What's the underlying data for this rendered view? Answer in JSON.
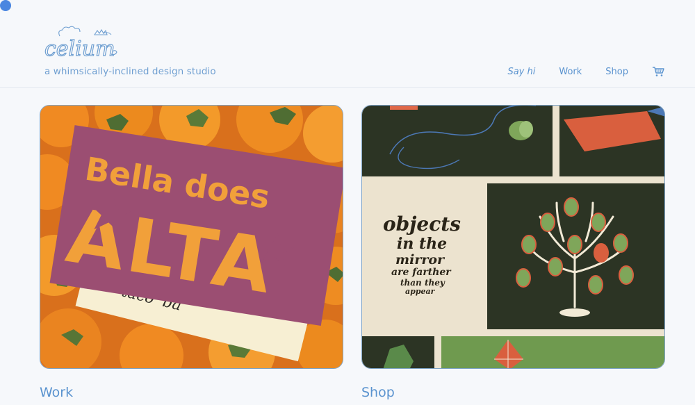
{
  "brand": {
    "logo_text": "celium",
    "tagline": "a whimsically-inclined design studio"
  },
  "nav": {
    "say_hi": "Say hi",
    "work": "Work",
    "shop": "Shop",
    "cart_icon": "cart-icon"
  },
  "cards": {
    "work": {
      "artwork_text_line1": "Bella does",
      "artwork_text_line2": "ALTA",
      "artwork_text_script": "taco' ba",
      "caption": "Work"
    },
    "shop": {
      "artwork_lines": [
        "objects",
        "in the",
        "mirror",
        "are farther",
        "than they",
        "appear"
      ],
      "caption": "Shop"
    }
  },
  "colors": {
    "accent": "#5a93cf",
    "background": "#f6f8fb",
    "alta_purple": "#9b4e72",
    "alta_orange": "#f1a03a",
    "poster_dark": "#2a3323",
    "poster_cream": "#ece3cf"
  }
}
